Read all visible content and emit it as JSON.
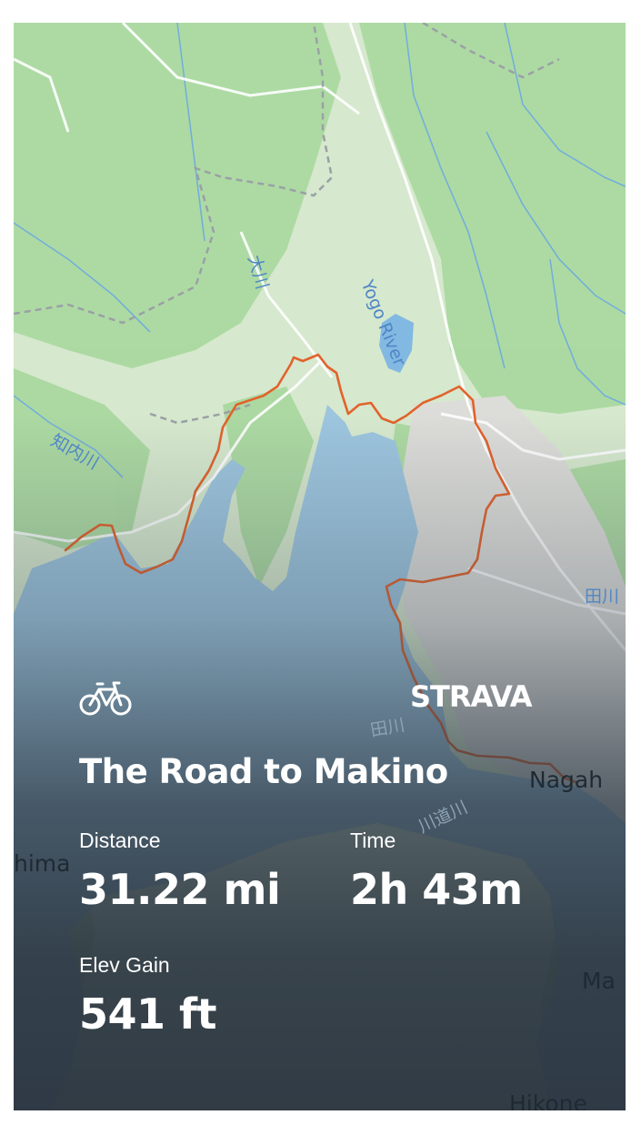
{
  "brand": {
    "name": "STRAVA",
    "accent": "#e2622c"
  },
  "activity": {
    "type_icon": "bike-icon",
    "title": "The Road to Makino"
  },
  "stats": {
    "distance": {
      "label": "Distance",
      "value": "31.22 mi"
    },
    "time": {
      "label": "Time",
      "value": "2h 43m"
    },
    "elevation": {
      "label": "Elev Gain",
      "value": "541 ft"
    }
  },
  "map": {
    "place_labels": [
      "Nagah",
      "hima",
      "Ma",
      "Hikone"
    ],
    "river_labels": [
      "Yogo River",
      "大川",
      "知内川",
      "田川",
      "田川",
      "川道川"
    ],
    "colors": {
      "land": "#cfe3c5",
      "forest": "#a9d8a0",
      "water": "#9cc3dc",
      "river": "#66a6e6",
      "road": "#ffffff",
      "route": "#e2622c"
    }
  }
}
